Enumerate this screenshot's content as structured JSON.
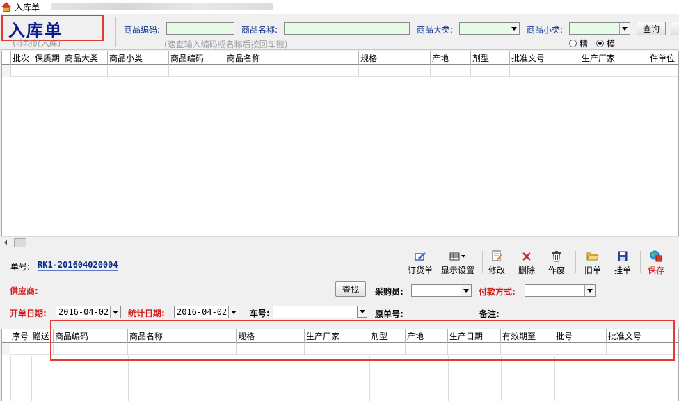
{
  "window": {
    "title": "入库单"
  },
  "form": {
    "title": "入库单",
    "subtitle": "(非均价入库)"
  },
  "search": {
    "code_label": "商品编码:",
    "name_label": "商品名称:",
    "category_label": "商品大类:",
    "subcategory_label": "商品小类:",
    "query_button": "查询",
    "hint": "(速查输入编码或名称后按回车键)",
    "mode_exact": "精",
    "mode_fuzzy": "模",
    "selected_mode": "模"
  },
  "top_grid": {
    "columns": [
      "批次",
      "保质期",
      "商品大类",
      "商品小类",
      "商品编码",
      "商品名称",
      "规格",
      "产地",
      "剂型",
      "批准文号",
      "生产厂家",
      "件单位"
    ]
  },
  "order": {
    "label": "单号:",
    "number": "RK1-201604020004"
  },
  "toolbar": {
    "order_goods": "订货单",
    "display_settings": "显示设置",
    "edit": "修改",
    "delete": "删除",
    "void": "作废",
    "old_order": "旧单",
    "hold": "挂单",
    "save": "保存"
  },
  "header_form": {
    "supplier_label": "供应商:",
    "find_button": "查找",
    "purchaser_label": "采购员:",
    "payment_label": "付款方式:",
    "open_date_label": "开单日期:",
    "open_date": "2016-04-02",
    "stat_date_label": "统计日期:",
    "stat_date": "2016-04-02",
    "vehicle_label": "车号:",
    "original_no_label": "原单号:",
    "remark_label": "备注:"
  },
  "detail_grid": {
    "columns": [
      "序号",
      "赠送",
      "商品编码",
      "商品名称",
      "规格",
      "生产厂家",
      "剂型",
      "产地",
      "生产日期",
      "有效期至",
      "批号",
      "批准文号"
    ]
  }
}
